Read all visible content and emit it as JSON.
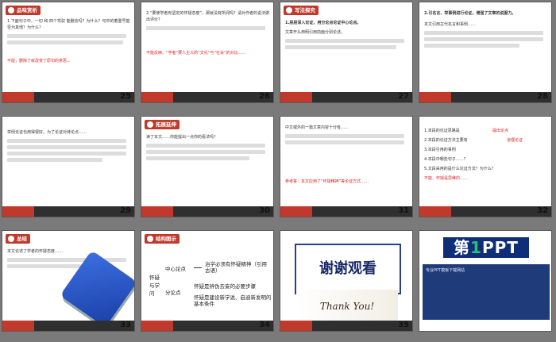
{
  "slides": [
    {
      "num": "25",
      "tag": "品味赏析",
      "title": "1.下面句子中，一切 和 四个驾驭 能删去吗？为什么？句中的着重号能否为其他？为什么？",
      "red": "不能，删除了就改变了原句的意思..."
    },
    {
      "num": "26",
      "title": "2.“要使学者有坚定的怀疑态度”，那就没有所闻吗？请对作者的说法做出评价？",
      "red": "不能反映。“学者”要人主义的“文化”与“社会”的对比……"
    },
    {
      "num": "27",
      "tag": "写法探究",
      "title": "1.层层深入论证，用分论点论证中心论点。",
      "body": "文章开头用明引用前面分别论述。"
    },
    {
      "num": "28",
      "title": "2.引名言、举事例进行论证，增强了文章的说服力。",
      "body": "本文引用古代名言和事例……"
    },
    {
      "num": "29",
      "body": "举例论证也用得很好。为了论证对待论点……"
    },
    {
      "num": "30",
      "tag": "拓展延伸",
      "body": "读了本文……你能提出一点你的看法吗？"
    },
    {
      "num": "31",
      "body": "中文或外的一篇文章内容十分有……",
      "red": "参考答：本文应用了“怀疑精神”等论证方式……"
    },
    {
      "num": "32",
      "q1": "1.本段的论证思路是",
      "a1": "提出论点",
      "q2": "2.本段的论证方法主要有",
      "a2": "道理论证",
      "q3": "3.本段引用的事例",
      "q4": "4.本段中哪些句子……？",
      "q5": "5.文段采用的是什么论证方法？为什么？",
      "red": "不能，怀疑是思维的……"
    },
    {
      "num": "33",
      "tag": "总结",
      "body": "本文论述了学者的怀疑态度……"
    },
    {
      "num": "34",
      "tag": "结构图示",
      "root": "怀疑与学问",
      "center": "中心论点",
      "center_text": "治学必须有怀疑精神（引用古语）",
      "sub": "分论点",
      "sub1": "怀疑是辨伪去妄的必要步骤",
      "sub2": "怀疑是建设新学说、启迪新发明的基本条件"
    },
    {
      "num": "35",
      "thanks": "谢谢观看",
      "thankyou": "Thank You!"
    },
    {
      "num": "",
      "logo_prefix": "第",
      "logo_one": "1",
      "logo_suffix": "PPT",
      "ad_text": "专业PPT模板下载网站"
    }
  ]
}
